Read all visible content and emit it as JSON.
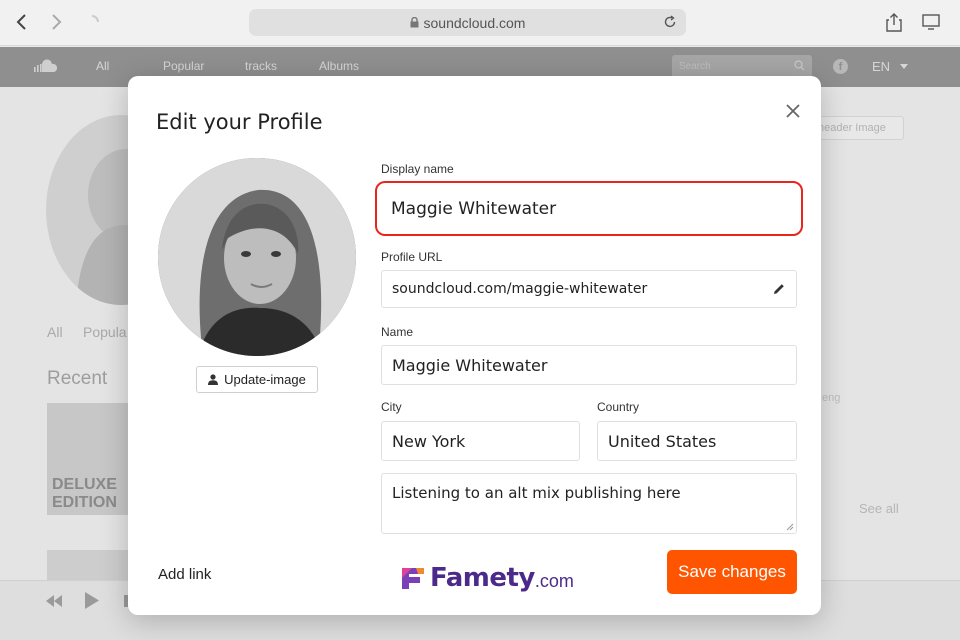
{
  "browser": {
    "url": "soundcloud.com"
  },
  "site": {
    "nav": [
      "All",
      "Popular",
      "tracks",
      "Albums"
    ],
    "search_placeholder": "Search",
    "language": "EN",
    "header_image_btn": "header Image",
    "profile_tabs": [
      "All",
      "Popula"
    ],
    "recent_heading": "Recent",
    "deluxe_line1": "DELUXE",
    "deluxe_line2": "EDITION",
    "faded_text": "eng",
    "see_all": "See all"
  },
  "modal": {
    "title": "Edit your Profile",
    "update_image_label": "Update-image",
    "display_name": {
      "label": "Display name",
      "value": "Maggie Whitewater"
    },
    "profile_url": {
      "label": "Profile URL",
      "value": "soundcloud.com/maggie-whitewater"
    },
    "name": {
      "label": "Name",
      "value": "Maggie Whitewater"
    },
    "city": {
      "label": "City",
      "value": "New York"
    },
    "country": {
      "label": "Country",
      "value": "United States"
    },
    "bio": {
      "value": "Listening to an alt mix publishing here"
    },
    "add_link_label": "Add link",
    "save_label": "Save changes",
    "watermark": {
      "name": "Famety",
      "suffix": ".com"
    }
  },
  "colors": {
    "accent": "#ff5500",
    "highlight": "#e8261b",
    "watermark": "#4b2a8a"
  },
  "icons": [
    "back-icon",
    "forward-icon",
    "lock-icon",
    "reload-icon",
    "share-icon",
    "display-icon",
    "soundcloud-logo-icon",
    "search-icon",
    "facebook-icon",
    "chevron-down-icon",
    "close-icon",
    "user-icon",
    "pencil-icon",
    "resize-handle-icon",
    "rewind-icon",
    "play-icon"
  ]
}
